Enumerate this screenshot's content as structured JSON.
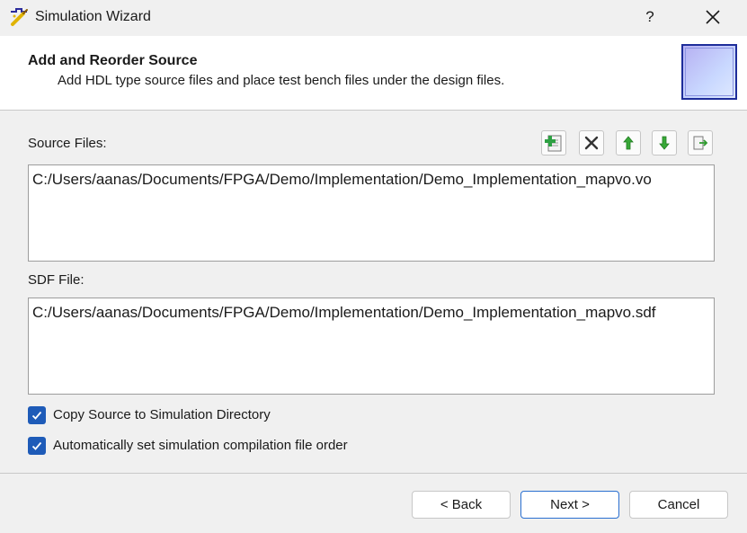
{
  "window": {
    "title": "Simulation Wizard",
    "help_label": "?",
    "icon": "simulation-wizard-icon"
  },
  "header": {
    "title": "Add and Reorder Source",
    "subtitle": "Add HDL type source files and place test bench files under the design files."
  },
  "source_files": {
    "label": "Source Files:",
    "items": [
      "C:/Users/aanas/Documents/FPGA/Demo/Implementation/Demo_Implementation_mapvo.vo"
    ],
    "toolbar": [
      "add-file-icon",
      "remove-icon",
      "move-up-icon",
      "move-down-icon",
      "export-icon"
    ]
  },
  "sdf_file": {
    "label": "SDF File:",
    "items": [
      "C:/Users/aanas/Documents/FPGA/Demo/Implementation/Demo_Implementation_mapvo.sdf"
    ]
  },
  "options": [
    {
      "label": "Copy Source to Simulation Directory",
      "checked": true
    },
    {
      "label": "Automatically set simulation compilation file order",
      "checked": true
    }
  ],
  "buttons": {
    "back": "< Back",
    "next": "Next >",
    "cancel": "Cancel"
  },
  "colors": {
    "checkbox": "#1e5bb8",
    "accent_border": "#2a6fd0",
    "arrow_green": "#2e9a2e"
  }
}
